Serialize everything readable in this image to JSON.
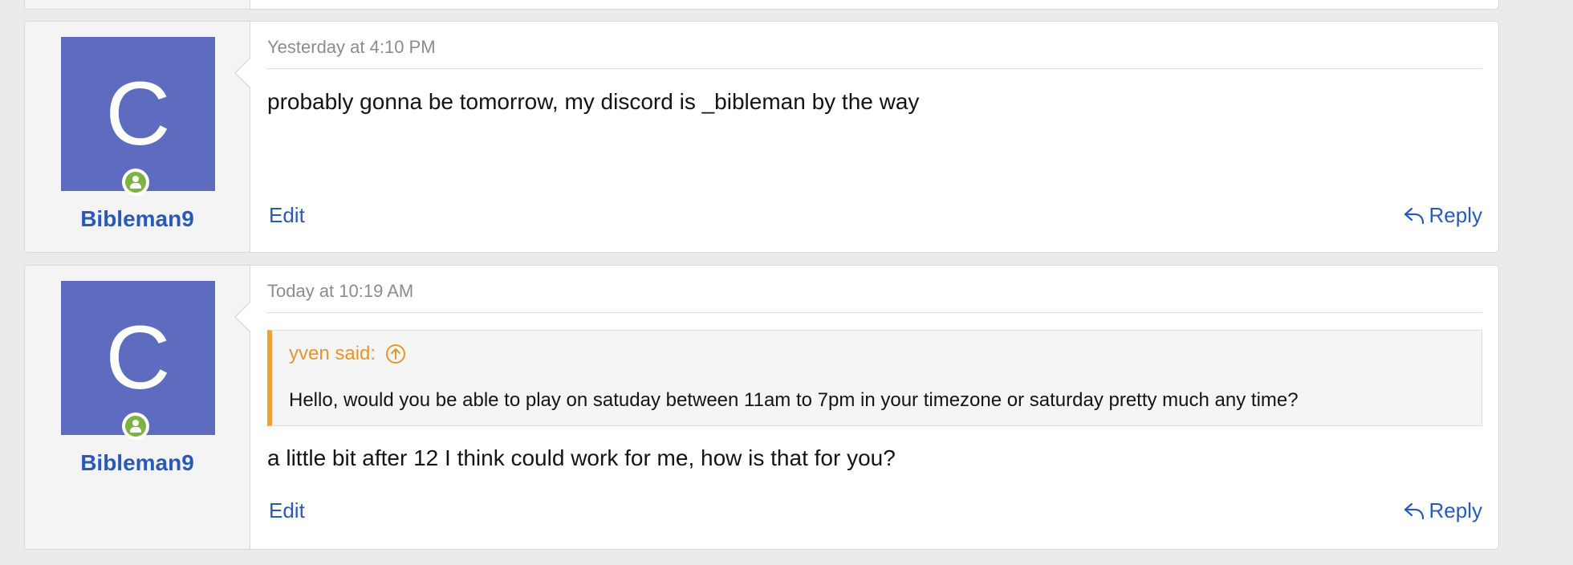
{
  "posts": [
    {
      "username": "Bibleman9",
      "avatar_letter": "C",
      "date": "Yesterday at 4:10 PM",
      "message": "probably gonna be tomorrow, my discord is _bibleman by the way",
      "edit_label": "Edit",
      "reply_label": "Reply"
    },
    {
      "username": "Bibleman9",
      "avatar_letter": "C",
      "date": "Today at 10:19 AM",
      "quote": {
        "author": "yven said:",
        "text": "Hello, would you be able to play on satuday between 11am to 7pm in your timezone or saturday pretty much any time?"
      },
      "message": "a little bit after 12 I think could work for me, how is that for you?",
      "edit_label": "Edit",
      "reply_label": "Reply"
    }
  ],
  "colors": {
    "avatar_bg": "#5e6cbf",
    "link": "#2a59b8",
    "online": "#7cb342",
    "quote_accent": "#f0a030"
  },
  "icons": {
    "online": "online-user-icon",
    "reply": "reply-arrow-icon",
    "quote_jump": "circle-arrow-up-icon"
  }
}
